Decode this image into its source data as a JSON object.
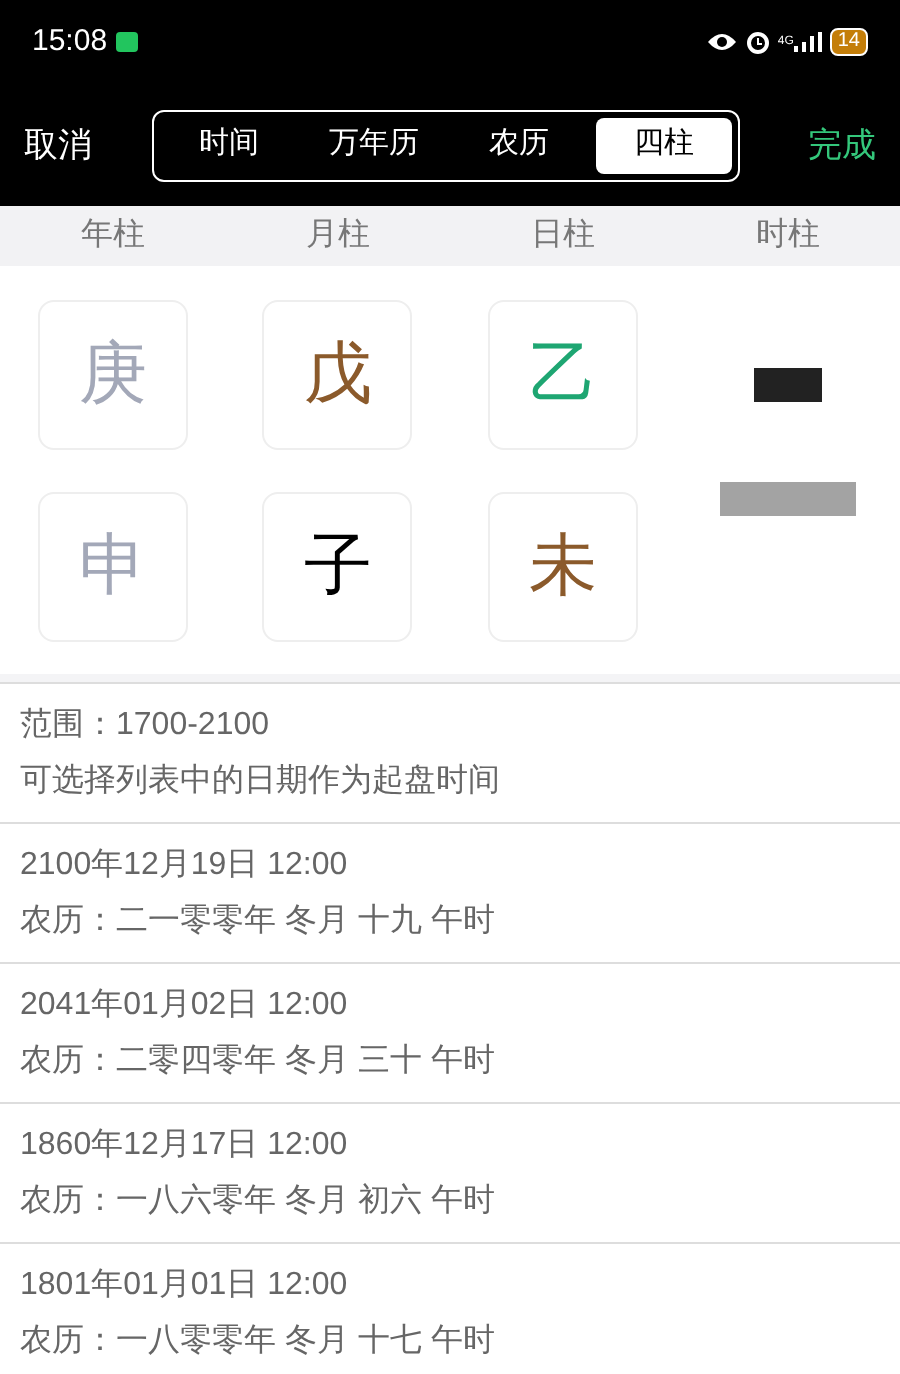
{
  "status_bar": {
    "time": "15:08",
    "network": "4G",
    "battery": "14"
  },
  "header": {
    "cancel": "取消",
    "done": "完成",
    "tabs": [
      {
        "label": "时间",
        "selected": false
      },
      {
        "label": "万年历",
        "selected": false
      },
      {
        "label": "农历",
        "selected": false
      },
      {
        "label": "四柱",
        "selected": true
      }
    ]
  },
  "pillars": [
    {
      "label": "年柱",
      "stem": {
        "text": "庚",
        "color": "#a3a8b8"
      },
      "branch": {
        "text": "申",
        "color": "#a3a8b8"
      }
    },
    {
      "label": "月柱",
      "stem": {
        "text": "戊",
        "color": "#8b5a2b"
      },
      "branch": {
        "text": "子",
        "color": "#000000"
      }
    },
    {
      "label": "日柱",
      "stem": {
        "text": "乙",
        "color": "#1ea672"
      },
      "branch": {
        "text": "未",
        "color": "#8b5a2b"
      }
    },
    {
      "label": "时柱"
    }
  ],
  "info": {
    "range": "范围：1700-2100",
    "hint": "可选择列表中的日期作为起盘时间"
  },
  "dates": [
    {
      "date": "2100年12月19日 12:00",
      "lunar": "农历：二一零零年 冬月 十九 午时"
    },
    {
      "date": "2041年01月02日 12:00",
      "lunar": "农历：二零四零年 冬月 三十 午时"
    },
    {
      "date": "1860年12月17日 12:00",
      "lunar": "农历：一八六零年 冬月 初六 午时"
    },
    {
      "date": "1801年01月01日 12:00",
      "lunar": "农历：一八零零年 冬月 十七 午时"
    }
  ]
}
